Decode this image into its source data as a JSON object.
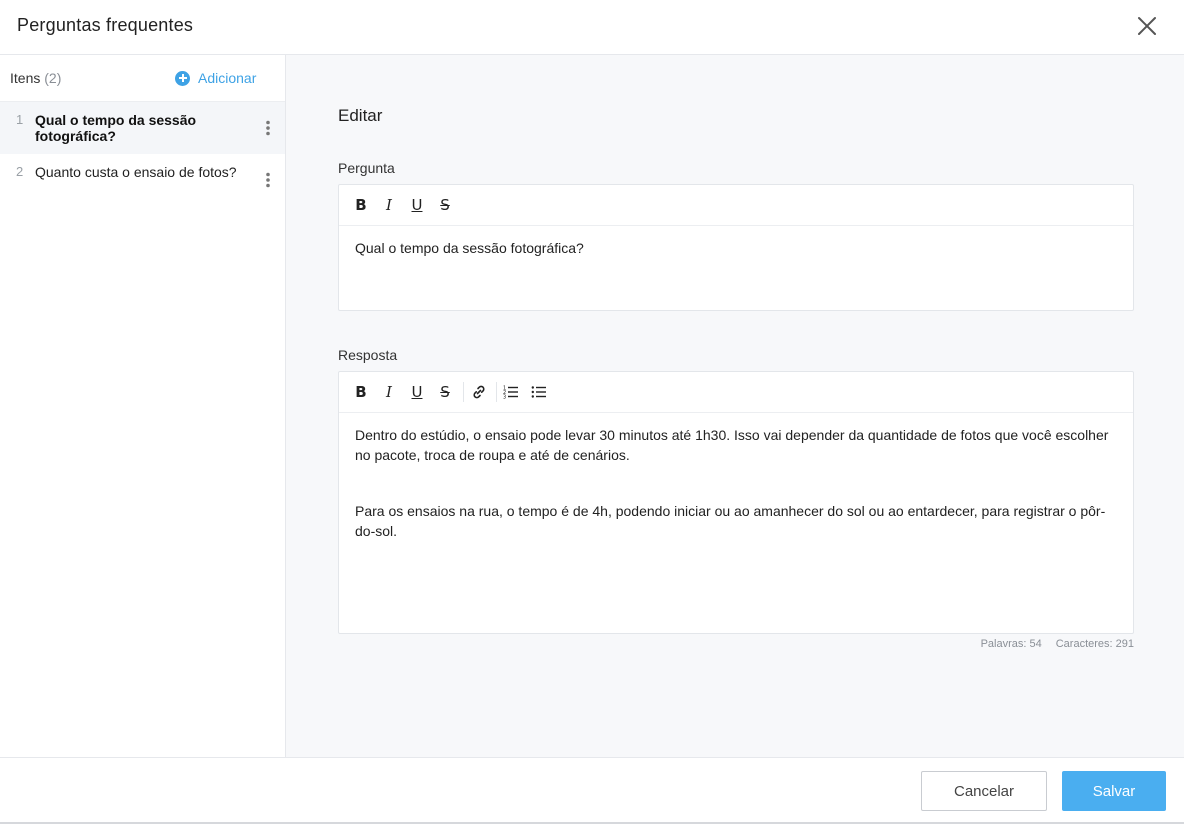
{
  "header": {
    "title": "Perguntas frequentes",
    "close_icon": "close-icon"
  },
  "sidebar": {
    "items_label": "Itens",
    "items_count": "(2)",
    "add_label": "Adicionar",
    "items": [
      {
        "number": "1",
        "text": "Qual o tempo da sessão fotográfica?",
        "active": true
      },
      {
        "number": "2",
        "text": "Quanto custa o ensaio de fotos?",
        "active": false
      }
    ]
  },
  "main": {
    "title": "Editar",
    "question": {
      "label": "Pergunta",
      "toolbar": [
        "B",
        "I",
        "U",
        "S"
      ],
      "value": "Qual o tempo da sessão fotográfica?"
    },
    "answer": {
      "label": "Resposta",
      "toolbar": [
        "B",
        "I",
        "U",
        "S"
      ],
      "paragraphs": [
        "Dentro do estúdio, o ensaio pode levar 30 minutos até 1h30. Isso vai depender da quantidade de fotos que você escolher no pacote, troca de roupa e até de cenários.",
        "Para os ensaios na rua, o tempo é de 4h, podendo iniciar ou ao amanhecer do sol ou ao entardecer, para registrar o pôr-do-sol."
      ],
      "words": "Palavras: 54",
      "characters": "Caracteres: 291"
    }
  },
  "footer": {
    "cancel_label": "Cancelar",
    "save_label": "Salvar"
  },
  "colors": {
    "accent": "#3ea2e5",
    "save_button": "#4aaef0",
    "active_item": "#f4f6f9",
    "panel_bg": "#f7f8fa"
  }
}
